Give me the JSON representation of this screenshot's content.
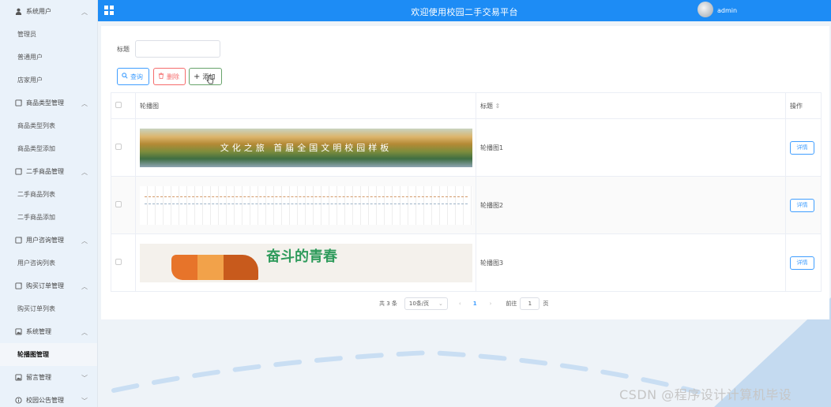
{
  "sidebar": {
    "groups": [
      {
        "label": "系统用户",
        "icon": "user-icon",
        "items": [
          "管理员",
          "普通用户",
          "店家用户"
        ]
      },
      {
        "label": "商品类型管理",
        "icon": "document-icon",
        "items": [
          "商品类型列表",
          "商品类型添加"
        ]
      },
      {
        "label": "二手商品管理",
        "icon": "document-icon",
        "items": [
          "二手商品列表",
          "二手商品添加"
        ]
      },
      {
        "label": "用户咨询管理",
        "icon": "document-icon",
        "items": [
          "用户咨询列表"
        ]
      },
      {
        "label": "购买订单管理",
        "icon": "document-icon",
        "items": [
          "购买订单列表"
        ]
      },
      {
        "label": "系统管理",
        "icon": "image-icon",
        "items": [
          "轮播图管理"
        ]
      },
      {
        "label": "留言管理",
        "icon": "image-icon",
        "items": []
      },
      {
        "label": "校园公告管理",
        "icon": "info-icon",
        "items": []
      }
    ],
    "active_item": "轮播图管理"
  },
  "header": {
    "title": "欢迎使用校园二手交易平台",
    "username": "admin",
    "accent": "#1d8cf5"
  },
  "search": {
    "title_label": "标题",
    "title_value": ""
  },
  "toolbar": {
    "query": "查询",
    "delete": "删除",
    "add": "添加"
  },
  "table": {
    "columns": [
      "轮播图",
      "标题",
      "操作"
    ],
    "rows": [
      {
        "title": "轮播图1",
        "action": "详情",
        "image_text": "文化之旅 首届全国文明校园样板"
      },
      {
        "title": "轮播图2",
        "action": "详情",
        "image_text": ""
      },
      {
        "title": "轮播图3",
        "action": "详情",
        "image_text": "奋斗的青春"
      }
    ]
  },
  "pagination": {
    "total": "共 3 条",
    "page_size": "10条/页",
    "current": "1",
    "goto_label": "前往",
    "goto_value": "1",
    "page_suffix": "页"
  },
  "watermark": "CSDN @程序设计计算机毕设"
}
